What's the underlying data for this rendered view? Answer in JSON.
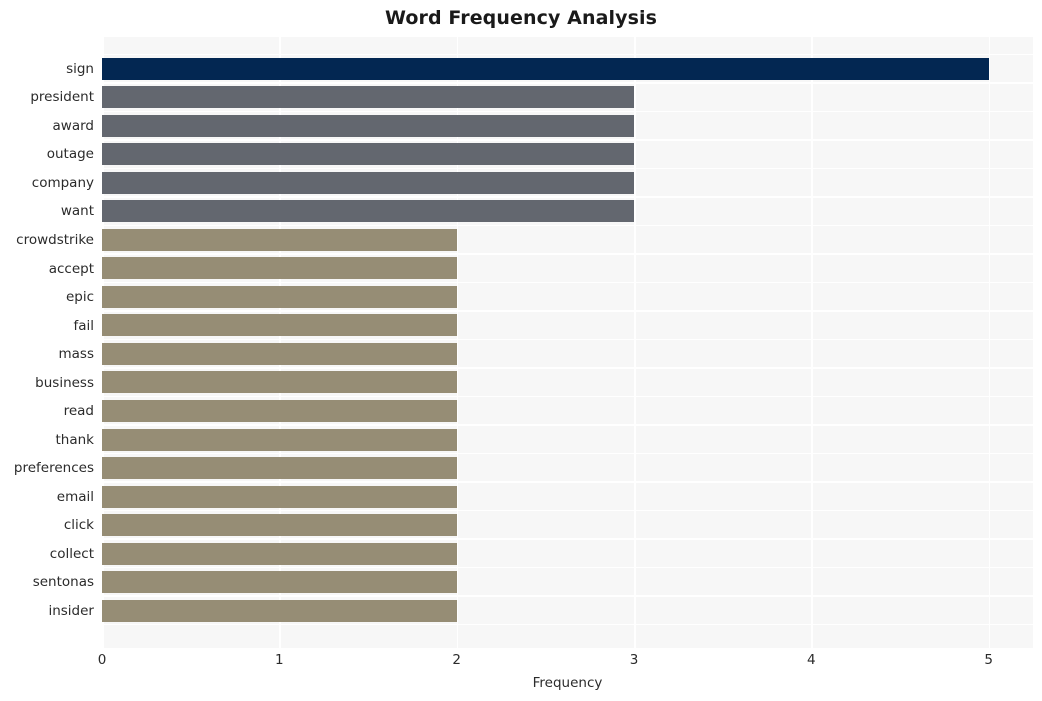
{
  "chart_data": {
    "type": "bar",
    "orientation": "horizontal",
    "title": "Word Frequency Analysis",
    "xlabel": "Frequency",
    "ylabel": "",
    "xlim": [
      0,
      5.25
    ],
    "xticks": [
      "0",
      "1",
      "2",
      "3",
      "4",
      "5"
    ],
    "xtick_values": [
      0,
      1,
      2,
      3,
      4,
      5
    ],
    "grid": true,
    "legend": "none",
    "categories": [
      "sign",
      "president",
      "award",
      "outage",
      "company",
      "want",
      "crowdstrike",
      "accept",
      "epic",
      "fail",
      "mass",
      "business",
      "read",
      "thank",
      "preferences",
      "email",
      "click",
      "collect",
      "sentonas",
      "insider"
    ],
    "values": [
      5,
      3,
      3,
      3,
      3,
      3,
      2,
      2,
      2,
      2,
      2,
      2,
      2,
      2,
      2,
      2,
      2,
      2,
      2,
      2
    ],
    "bar_colors": [
      "#032752",
      "#63676f",
      "#63676f",
      "#63676f",
      "#63676f",
      "#63676f",
      "#968d75",
      "#968d75",
      "#968d75",
      "#968d75",
      "#968d75",
      "#968d75",
      "#968d75",
      "#968d75",
      "#968d75",
      "#968d75",
      "#968d75",
      "#968d75",
      "#968d75",
      "#968d75"
    ]
  },
  "style": {
    "plot_background": "#f7f7f7",
    "figure_background": "#ffffff",
    "gridline_color": "#ffffff",
    "text_color": "#2b2b2b",
    "title_color": "#1a1a1a",
    "color_high": "#032752",
    "color_mid": "#63676f",
    "color_low": "#968d75"
  }
}
